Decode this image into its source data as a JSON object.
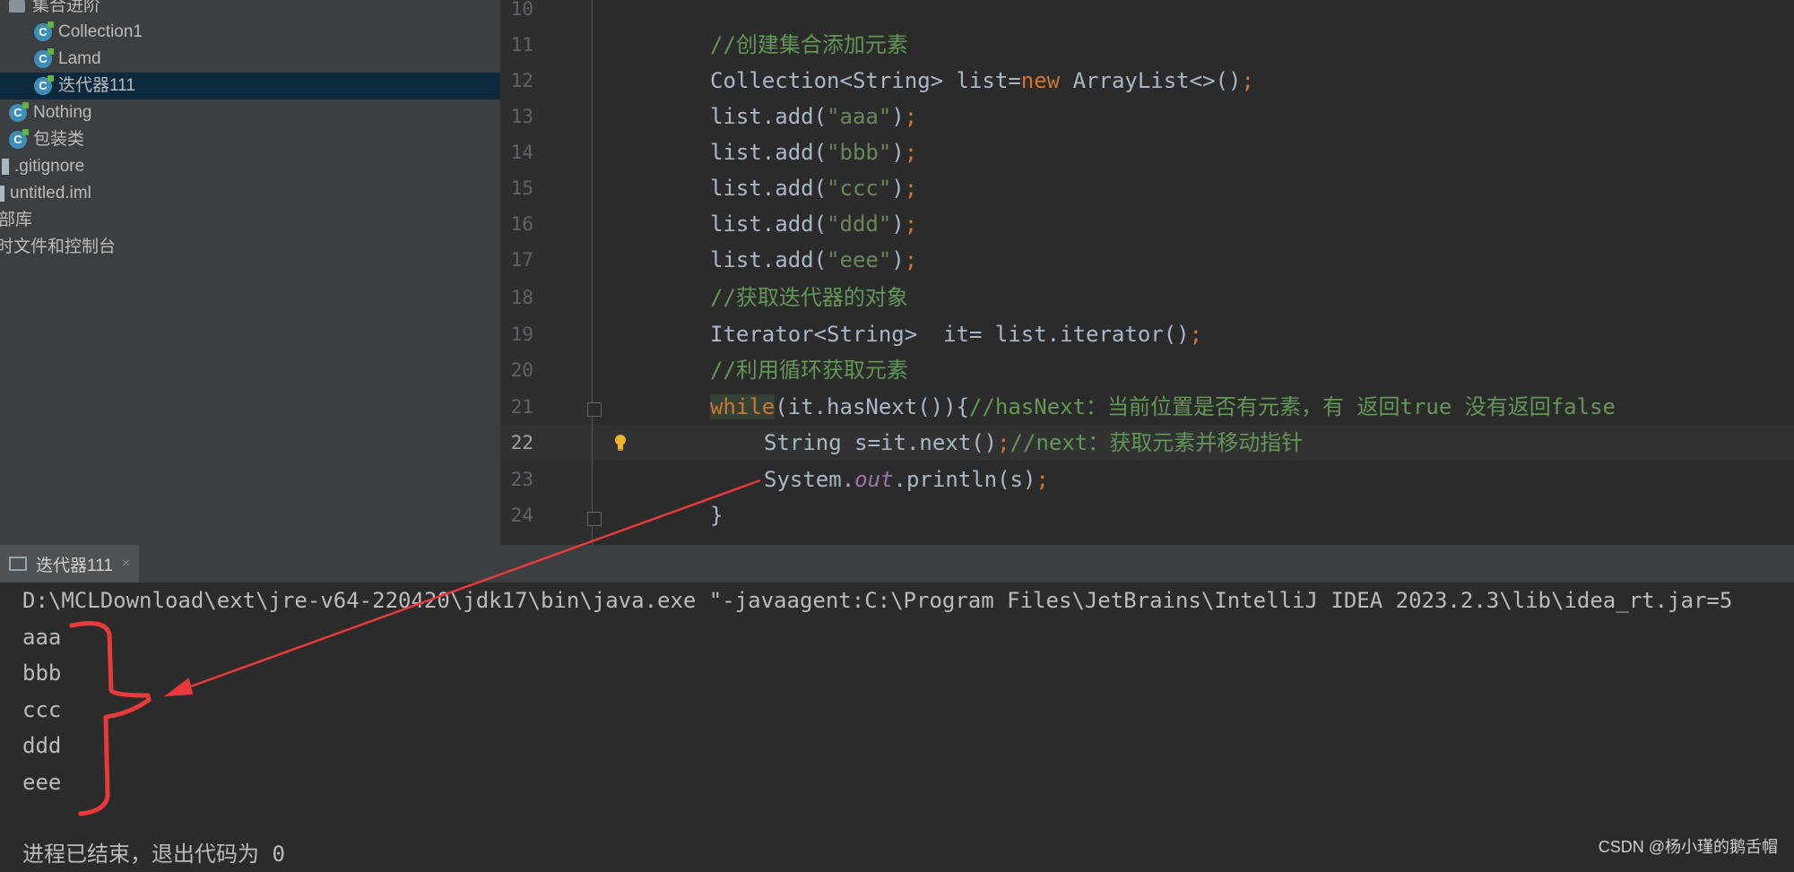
{
  "project": {
    "folder_label": "集合进阶",
    "items": [
      "Collection1",
      "Lamd",
      "迭代器111",
      "Nothing",
      "包装类",
      ".gitignore",
      "untitled.iml",
      "部库",
      "时文件和控制台"
    ]
  },
  "editor": {
    "line_numbers": [
      "10",
      "11",
      "12",
      "13",
      "14",
      "15",
      "16",
      "17",
      "18",
      "19",
      "20",
      "21",
      "22",
      "23",
      "24"
    ],
    "lines": {
      "l11": "//创建集合添加元素",
      "l12a": "Collection<String> list=",
      "l12b": "new",
      "l12c": " ArrayList<>()",
      "l12d": ";",
      "add": "list.add(",
      "aaa": "\"aaa\"",
      "bbb": "\"bbb\"",
      "ccc": "\"ccc\"",
      "ddd": "\"ddd\"",
      "eee": "\"eee\"",
      "close": ")",
      "semi": ";",
      "l18": "//获取迭代器的对象",
      "l19a": "Iterator<String>  it= list.iterator()",
      "l20": "//利用循环获取元素",
      "l21a": "while",
      "l21b": "(it.hasNext()){",
      "l21c": "//hasNext：当前位置是否有元素，有 返回true 没有返回false",
      "l22a": "String s=it.next()",
      "l22c": "//next：获取元素并移动指针",
      "l23a": "System.",
      "l23b": "out",
      "l23c": ".println(s)",
      "l24": "}"
    }
  },
  "run": {
    "tab_label": "迭代器111",
    "close_glyph": "×",
    "command": "D:\\MCLDownload\\ext\\jre-v64-220420\\jdk17\\bin\\java.exe \"-javaagent:C:\\Program Files\\JetBrains\\IntelliJ IDEA 2023.2.3\\lib\\idea_rt.jar=5",
    "output": [
      "aaa",
      "bbb",
      "ccc",
      "ddd",
      "eee"
    ],
    "exit_message": "进程已结束，退出代码为 0"
  },
  "watermark": "CSDN @杨小瑾的鹅舌帽",
  "colors": {
    "annotation": "#e83a3a",
    "keyword": "#cc7832",
    "string": "#6a8759",
    "comment": "#629755"
  }
}
